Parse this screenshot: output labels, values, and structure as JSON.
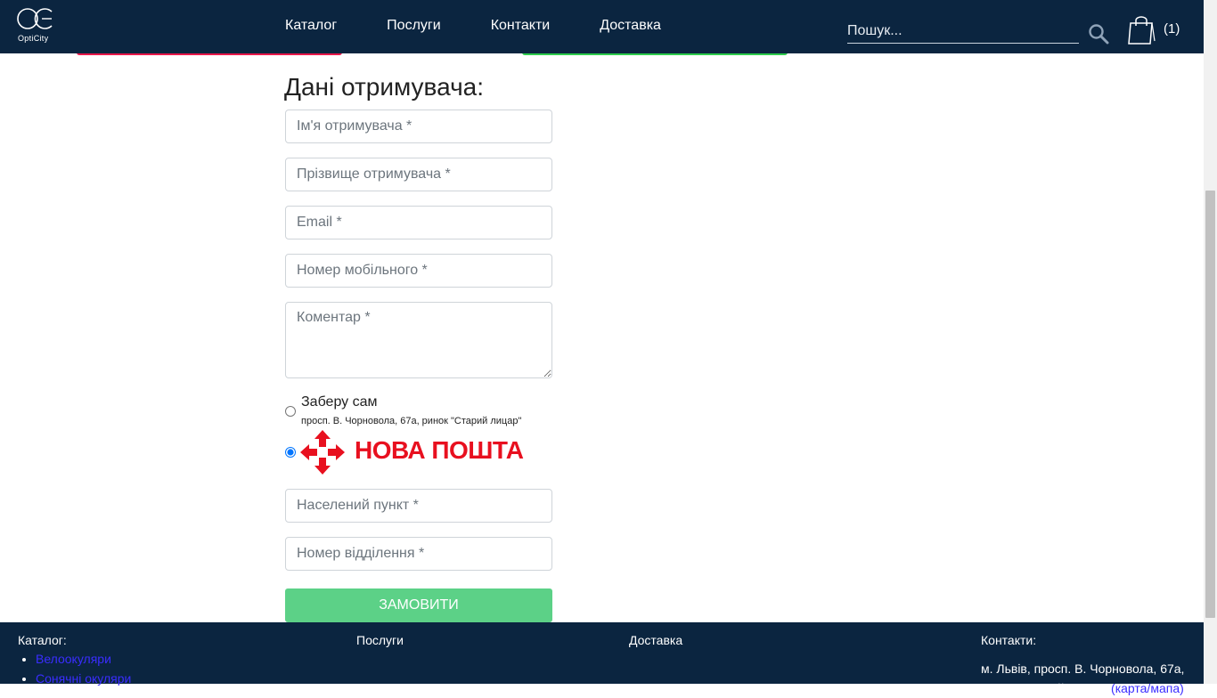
{
  "header": {
    "logo_text": "OptiCity",
    "nav": [
      "Каталог",
      "Послуги",
      "Контакти",
      "Доставка"
    ],
    "search_placeholder": "Пошук...",
    "cart_count": "(1)"
  },
  "form": {
    "title": "Дані отримувача:",
    "fields": {
      "first_name": "Ім'я отримувача *",
      "last_name": "Прізвище отримувача *",
      "email": "Email *",
      "phone": "Номер мобільного *",
      "comment": "Коментар *",
      "city": "Населений пункт *",
      "branch": "Номер відділення *"
    },
    "delivery": {
      "pickup_label": "Заберу сам",
      "pickup_address": "просп. В. Чорновола, 67а, ринок \"Старий лицар\"",
      "nova_poshta_label": "НОВА ПОШТА",
      "selected": "nova_poshta"
    },
    "submit_label": "ЗАМОВИТИ"
  },
  "footer": {
    "catalog_title": "Каталог:",
    "catalog_items": [
      "Велоокуляри",
      "Сонячні окуляри"
    ],
    "services_title": "Послуги",
    "delivery_title": "Доставка",
    "contacts_title": "Контакти:",
    "address_line1": "м. Львів, просп. В. Чорновола, 67а,",
    "address_line2": "ринок \"Старий лицар\"",
    "address_link": "(карта/мапа)"
  },
  "colors": {
    "header_bg": "#0b2540",
    "submit_bg": "#5cd187",
    "accent_red": "#e8184a",
    "accent_green": "#2ecc4c",
    "nova_poshta_red": "#e8101f"
  }
}
